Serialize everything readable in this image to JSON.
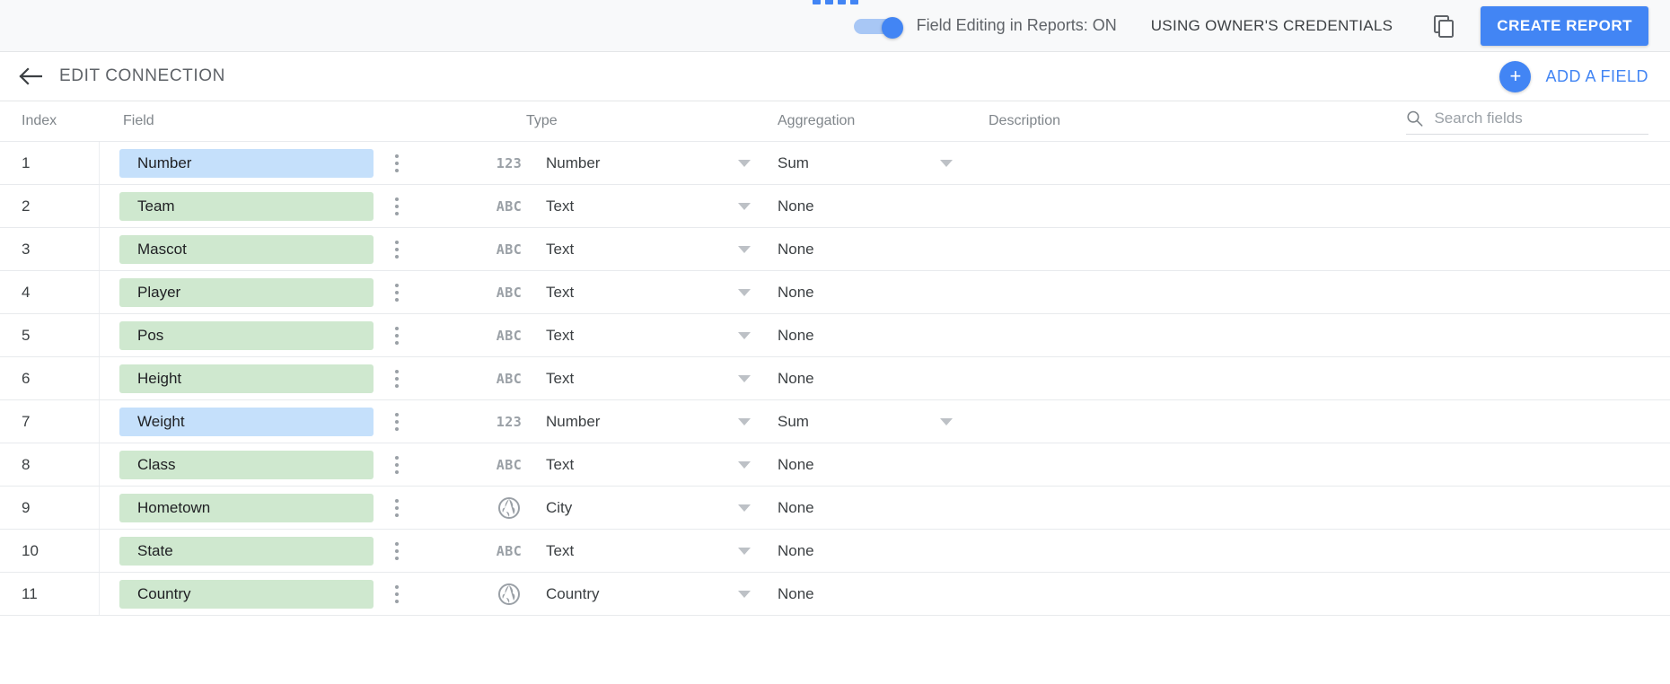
{
  "topbar": {
    "toggle_label": "Field Editing in Reports: ON",
    "toggle_state": "on",
    "credentials_label": "USING OWNER'S CREDENTIALS",
    "copy_icon": "copy-icon",
    "create_report_label": "CREATE REPORT",
    "accent_color": "#4285f4"
  },
  "subheader": {
    "back_icon": "arrow-left-icon",
    "title": "EDIT CONNECTION",
    "add_field_icon": "plus-icon",
    "add_field_label": "ADD A FIELD"
  },
  "table": {
    "headers": {
      "index": "Index",
      "field": "Field",
      "type": "Type",
      "aggregation": "Aggregation",
      "description": "Description"
    },
    "search": {
      "icon": "search-icon",
      "placeholder": "Search fields",
      "value": ""
    },
    "rows": [
      {
        "index": "1",
        "field": "Number",
        "chip": "num",
        "type_glyph": "123",
        "type_icon": "number-icon",
        "type": "Number",
        "aggregation": "Sum",
        "agg_caret": true,
        "description": ""
      },
      {
        "index": "2",
        "field": "Team",
        "chip": "text",
        "type_glyph": "ABC",
        "type_icon": "text-icon",
        "type": "Text",
        "aggregation": "None",
        "agg_caret": false,
        "description": ""
      },
      {
        "index": "3",
        "field": "Mascot",
        "chip": "text",
        "type_glyph": "ABC",
        "type_icon": "text-icon",
        "type": "Text",
        "aggregation": "None",
        "agg_caret": false,
        "description": ""
      },
      {
        "index": "4",
        "field": "Player",
        "chip": "text",
        "type_glyph": "ABC",
        "type_icon": "text-icon",
        "type": "Text",
        "aggregation": "None",
        "agg_caret": false,
        "description": ""
      },
      {
        "index": "5",
        "field": "Pos",
        "chip": "text",
        "type_glyph": "ABC",
        "type_icon": "text-icon",
        "type": "Text",
        "aggregation": "None",
        "agg_caret": false,
        "description": ""
      },
      {
        "index": "6",
        "field": "Height",
        "chip": "text",
        "type_glyph": "ABC",
        "type_icon": "text-icon",
        "type": "Text",
        "aggregation": "None",
        "agg_caret": false,
        "description": ""
      },
      {
        "index": "7",
        "field": "Weight",
        "chip": "num",
        "type_glyph": "123",
        "type_icon": "number-icon",
        "type": "Number",
        "aggregation": "Sum",
        "agg_caret": true,
        "description": ""
      },
      {
        "index": "8",
        "field": "Class",
        "chip": "text",
        "type_glyph": "ABC",
        "type_icon": "text-icon",
        "type": "Text",
        "aggregation": "None",
        "agg_caret": false,
        "description": ""
      },
      {
        "index": "9",
        "field": "Hometown",
        "chip": "text",
        "type_glyph": "",
        "type_icon": "globe-icon",
        "type": "City",
        "aggregation": "None",
        "agg_caret": false,
        "description": ""
      },
      {
        "index": "10",
        "field": "State",
        "chip": "text",
        "type_glyph": "ABC",
        "type_icon": "text-icon",
        "type": "Text",
        "aggregation": "None",
        "agg_caret": false,
        "description": ""
      },
      {
        "index": "11",
        "field": "Country",
        "chip": "text",
        "type_glyph": "",
        "type_icon": "globe-icon",
        "type": "Country",
        "aggregation": "None",
        "agg_caret": false,
        "description": ""
      }
    ]
  },
  "colors": {
    "chip_number": "#c5e0fb",
    "chip_text": "#cfe8cf",
    "accent": "#4285f4",
    "topbar_bg": "#f8f9fa"
  }
}
